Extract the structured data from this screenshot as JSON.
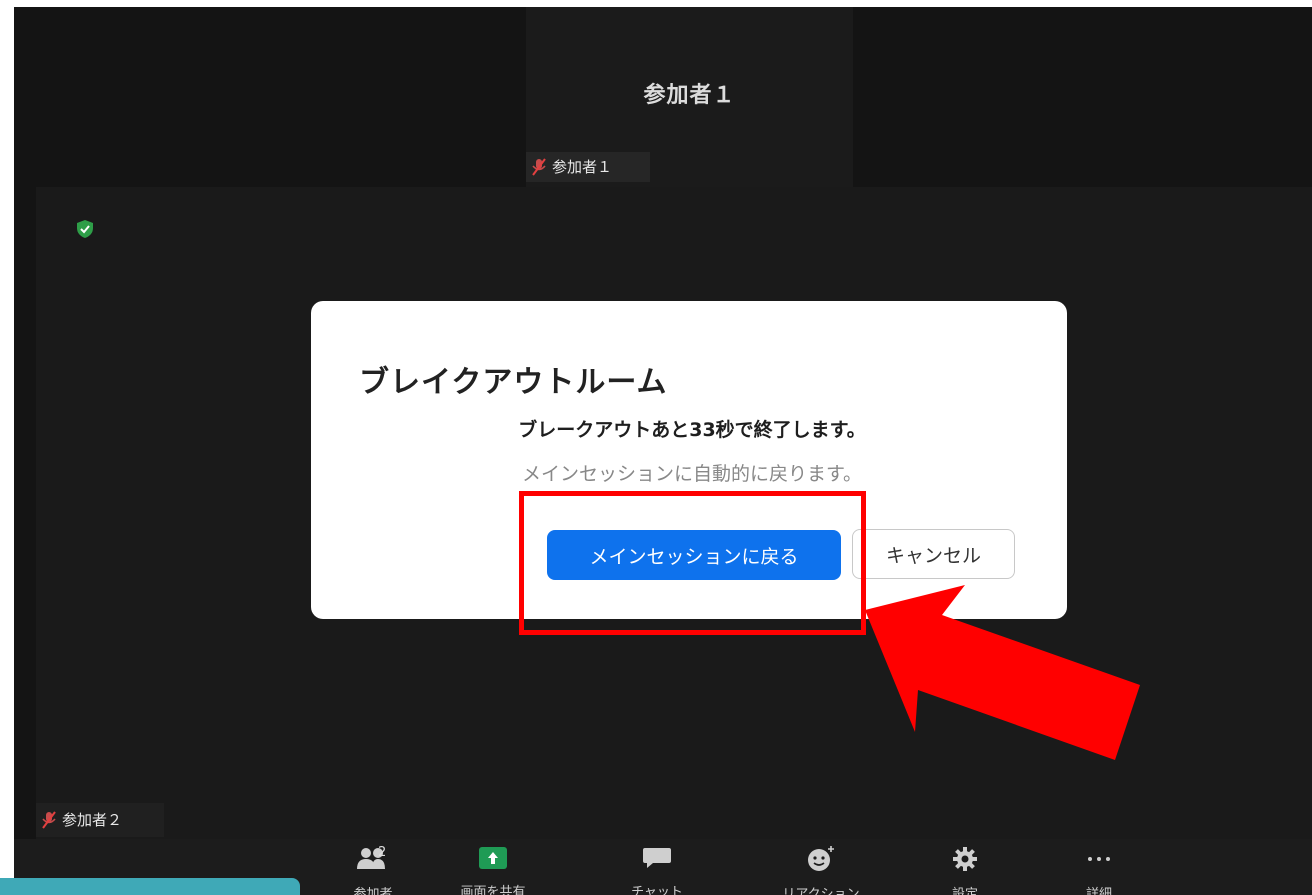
{
  "gallery": {
    "participant1": {
      "display_name": "参加者１",
      "tag_label": "参加者１"
    },
    "participant2": {
      "tag_label": "参加者２"
    }
  },
  "dialog": {
    "title": "ブレイクアウトルーム",
    "message": "ブレークアウトあと33秒で終了します。",
    "submessage": "メインセッションに自動的に戻ります。",
    "primary_button": "メインセッションに戻る",
    "cancel_button": "キャンセル"
  },
  "toolbar": {
    "participants_count": "2",
    "items": [
      {
        "label": "参加者",
        "icon": "participants-icon"
      },
      {
        "label": "画面を共有",
        "icon": "share-screen-icon"
      },
      {
        "label": "チャット",
        "icon": "chat-icon"
      },
      {
        "label": "リアクション",
        "icon": "reactions-icon"
      },
      {
        "label": "設定",
        "icon": "gear-icon"
      },
      {
        "label": "詳細",
        "icon": "more-icon"
      }
    ]
  },
  "colors": {
    "primary_button": "#0e72ed",
    "highlight": "#ff0000",
    "shield": "#2e9e48",
    "share": "#1f9b55"
  }
}
